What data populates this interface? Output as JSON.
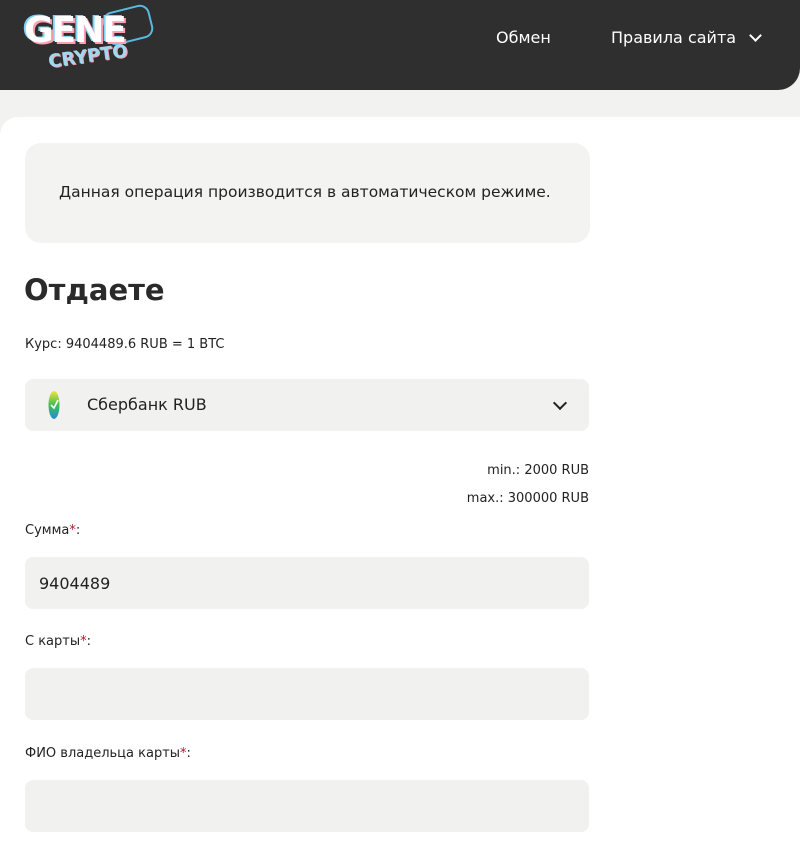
{
  "header": {
    "logo_text": "GENE",
    "logo_sub": "CRYPTO",
    "nav": {
      "exchange": "Обмен",
      "rules": "Правила сайта"
    }
  },
  "notice": {
    "text": "Данная операция производится в автоматическом режиме."
  },
  "give": {
    "title": "Отдаете",
    "rate": "Курс: 9404489.6 RUB = 1 BTC",
    "currency": {
      "selected": "Сбербанк RUB",
      "icon": "sberbank-logo-icon"
    },
    "limits": {
      "min": "min.: 2000 RUB",
      "max": "max.: 300000 RUB"
    },
    "fields": {
      "amount": {
        "label": "Сумма",
        "value": "9404489"
      },
      "card": {
        "label": "С карты",
        "value": ""
      },
      "holder": {
        "label": "ФИО владельца карты",
        "value": ""
      },
      "required_mark": "*",
      "label_suffix": ":"
    }
  },
  "colors": {
    "header_bg": "#2f2f2f",
    "field_bg": "#f1f1f0",
    "required": "#b3142f"
  }
}
